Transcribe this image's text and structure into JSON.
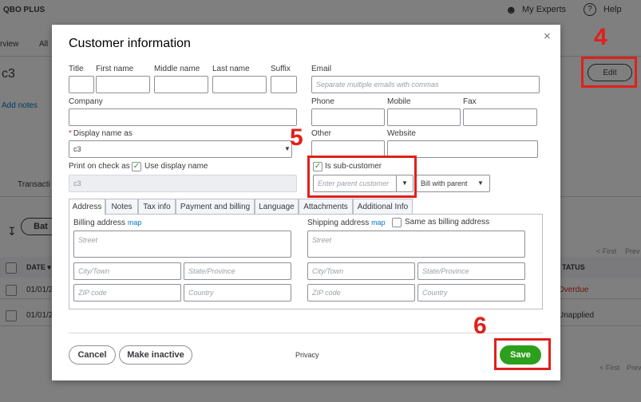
{
  "background": {
    "app_name": "QBO PLUS",
    "my_experts": "My Experts",
    "help": "Help",
    "tabs": [
      "rview",
      "All"
    ],
    "customer_name": "c3",
    "add_notes": "Add notes",
    "edit_label": "Edit",
    "transactions_tab": "Transacti",
    "batch_button": "Bat",
    "first_label": "< First",
    "prev_label": "Prev",
    "date_header": "DATE ▾",
    "status_header": "TATUS",
    "rows": [
      {
        "date": "01/01/2",
        "status": "Overdue"
      },
      {
        "date": "01/01/2",
        "status": "Unapplied"
      }
    ],
    "bottom_first": "< First",
    "bottom_prev": "Prev"
  },
  "modal": {
    "title": "Customer information",
    "close": "×",
    "title_label": "Title",
    "first_name_label": "First name",
    "middle_name_label": "Middle name",
    "last_name_label": "Last name",
    "suffix_label": "Suffix",
    "email_label": "Email",
    "email_placeholder": "Separate multiple emails with commas",
    "company_label": "Company",
    "phone_label": "Phone",
    "mobile_label": "Mobile",
    "fax_label": "Fax",
    "display_name_label": "Display name as",
    "display_name_value": "c3",
    "other_label": "Other",
    "website_label": "Website",
    "print_on_check_label": "Print on check as",
    "use_display_name_label": "Use display name",
    "print_on_check_value": "c3",
    "sub_customer_label": "Is sub-customer",
    "parent_customer_placeholder": "Enter parent customer",
    "bill_with_parent": "Bill with parent",
    "tabs": [
      "Address",
      "Notes",
      "Tax info",
      "Payment and billing",
      "Language",
      "Attachments",
      "Additional Info"
    ],
    "billing_address_label": "Billing address",
    "shipping_address_label": "Shipping address",
    "map_link": "map",
    "same_as_billing_label": "Same as billing address",
    "street_placeholder": "Street",
    "city_placeholder": "City/Town",
    "state_placeholder": "State/Province",
    "zip_placeholder": "ZIP code",
    "country_placeholder": "Country",
    "cancel_label": "Cancel",
    "make_inactive_label": "Make inactive",
    "privacy_label": "Privacy",
    "save_label": "Save"
  },
  "annotations": {
    "step4": "4",
    "step5": "5",
    "step6": "6"
  },
  "colors": {
    "accent_green": "#2ca01c",
    "annotation_red": "#e0201c",
    "link_blue": "#0077c5"
  },
  "icons": [
    "person-icon",
    "help-icon",
    "close-icon",
    "chevron-down-icon",
    "checkmark-icon",
    "sort-icon"
  ]
}
